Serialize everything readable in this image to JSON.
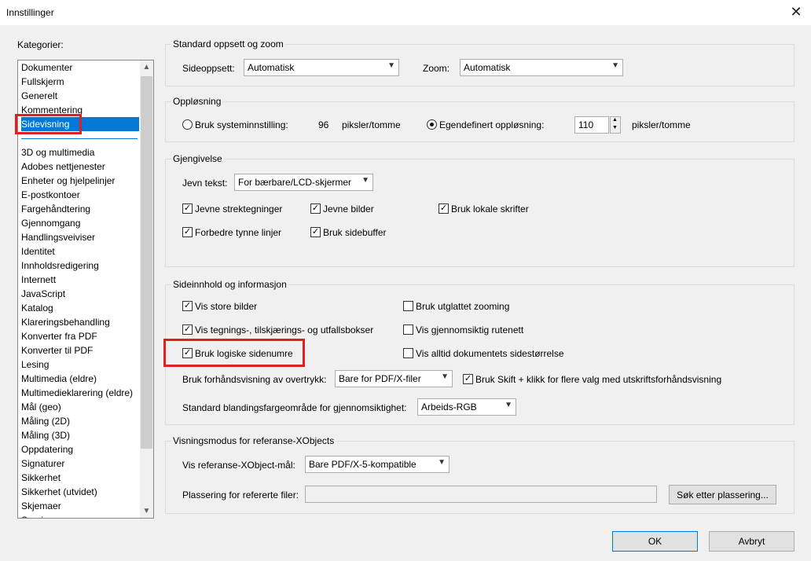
{
  "window": {
    "title": "Innstillinger",
    "close_glyph": "✕"
  },
  "categories": {
    "label": "Kategorier:",
    "group1": [
      "Dokumenter",
      "Fullskjerm",
      "Generelt",
      "Kommentering",
      "Sidevisning"
    ],
    "selected": "Sidevisning",
    "group2": [
      "3D og multimedia",
      "Adobes nettjenester",
      "Enheter og hjelpelinjer",
      "E-postkontoer",
      "Fargehåndtering",
      "Gjennomgang",
      "Handlingsveiviser",
      "Identitet",
      "Innholdsredigering",
      "Internett",
      "JavaScript",
      "Katalog",
      "Klareringsbehandling",
      "Konverter fra PDF",
      "Konverter til PDF",
      "Lesing",
      "Multimedia (eldre)",
      "Multimedieklarering (eldre)",
      "Mål (geo)",
      "Måling (2D)",
      "Måling (3D)",
      "Oppdatering",
      "Signaturer",
      "Sikkerhet",
      "Sikkerhet (utvidet)",
      "Skjemaer",
      "Sporing"
    ]
  },
  "layout_zoom": {
    "title": "Standard oppsett og zoom",
    "layout_label": "Sideoppsett:",
    "layout_value": "Automatisk",
    "zoom_label": "Zoom:",
    "zoom_value": "Automatisk"
  },
  "resolution": {
    "title": "Oppløsning",
    "system_label": "Bruk systeminnstilling:",
    "system_value": "96",
    "system_unit": "piksler/tomme",
    "custom_label": "Egendefinert oppløsning:",
    "custom_value": "110",
    "custom_unit": "piksler/tomme",
    "selected": "custom"
  },
  "rendering": {
    "title": "Gjengivelse",
    "smooth_label": "Jevn tekst:",
    "smooth_value": "For bærbare/LCD-skjermer",
    "checks": [
      {
        "label": "Jevne strektegninger",
        "checked": true
      },
      {
        "label": "Jevne bilder",
        "checked": true
      },
      {
        "label": "Bruk lokale skrifter",
        "checked": true
      },
      {
        "label": "Forbedre tynne linjer",
        "checked": true
      },
      {
        "label": "Bruk sidebuffer",
        "checked": true
      }
    ]
  },
  "page_content": {
    "title": "Sideinnhold og informasjon",
    "checks": [
      {
        "label": "Vis store bilder",
        "checked": true
      },
      {
        "label": "Bruk utglattet zooming",
        "checked": false
      },
      {
        "label": "Vis tegnings-, tilskjærings- og utfallsbokser",
        "checked": true
      },
      {
        "label": "Vis gjennomsiktig rutenett",
        "checked": false
      },
      {
        "label": "Bruk logiske sidenumre",
        "checked": true
      },
      {
        "label": "Vis alltid dokumentets sidestørrelse",
        "checked": false
      },
      {
        "label": "Bruk Skift + klikk for flere valg med utskriftsforhåndsvisning",
        "checked": true
      }
    ],
    "overprint_label": "Bruk forhåndsvisning av overtrykk:",
    "overprint_value": "Bare for PDF/X-filer",
    "blend_label": "Standard blandingsfargeområde for gjennomsiktighet:",
    "blend_value": "Arbeids-RGB"
  },
  "xobjects": {
    "title": "Visningsmodus for referanse-XObjects",
    "target_label": "Vis referanse-XObject-mål:",
    "target_value": "Bare PDF/X-5-kompatible",
    "location_label": "Plassering for refererte filer:",
    "location_value": "",
    "browse_button": "Søk etter plassering..."
  },
  "buttons": {
    "ok": "OK",
    "cancel": "Avbryt"
  },
  "glyphs": {
    "check": "✓",
    "dropdown": "▼",
    "up": "▲",
    "down": "▼"
  }
}
